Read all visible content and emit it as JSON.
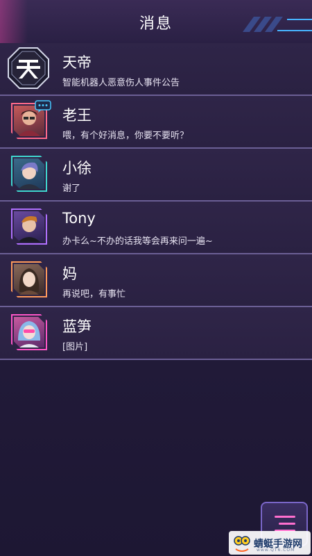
{
  "header": {
    "title": "消息"
  },
  "conversations": [
    {
      "name": "天帝",
      "preview": "智能机器人恶意伤人事件公告",
      "avatar": "tiandi-logo-icon",
      "frame_color": "#cfd3e6"
    },
    {
      "name": "老王",
      "preview": "喂，有个好消息，你要不要听？",
      "avatar": "laowang-avatar",
      "frame_color": "#ff6a8a",
      "unread_bubble": "speech-bubble-icon"
    },
    {
      "name": "小徐",
      "preview": "谢了",
      "avatar": "xiaoxu-avatar",
      "frame_color": "#3fd8d0"
    },
    {
      "name": "Tony",
      "preview": "办卡么~不办的话我等会再来问一遍~",
      "avatar": "tony-avatar",
      "frame_color": "#b070ff"
    },
    {
      "name": "妈",
      "preview": "再说吧，有事忙",
      "avatar": "mom-avatar",
      "frame_color": "#ff9a5a"
    },
    {
      "name": "蓝笋",
      "preview": "[图片]",
      "avatar": "lansun-avatar",
      "frame_color": "#ff55c8"
    }
  ],
  "watermark": {
    "text": "蜻蜓手游网",
    "sub": "www.QT6.COM"
  },
  "menu_button": {
    "icon": "menu-lines-icon"
  }
}
